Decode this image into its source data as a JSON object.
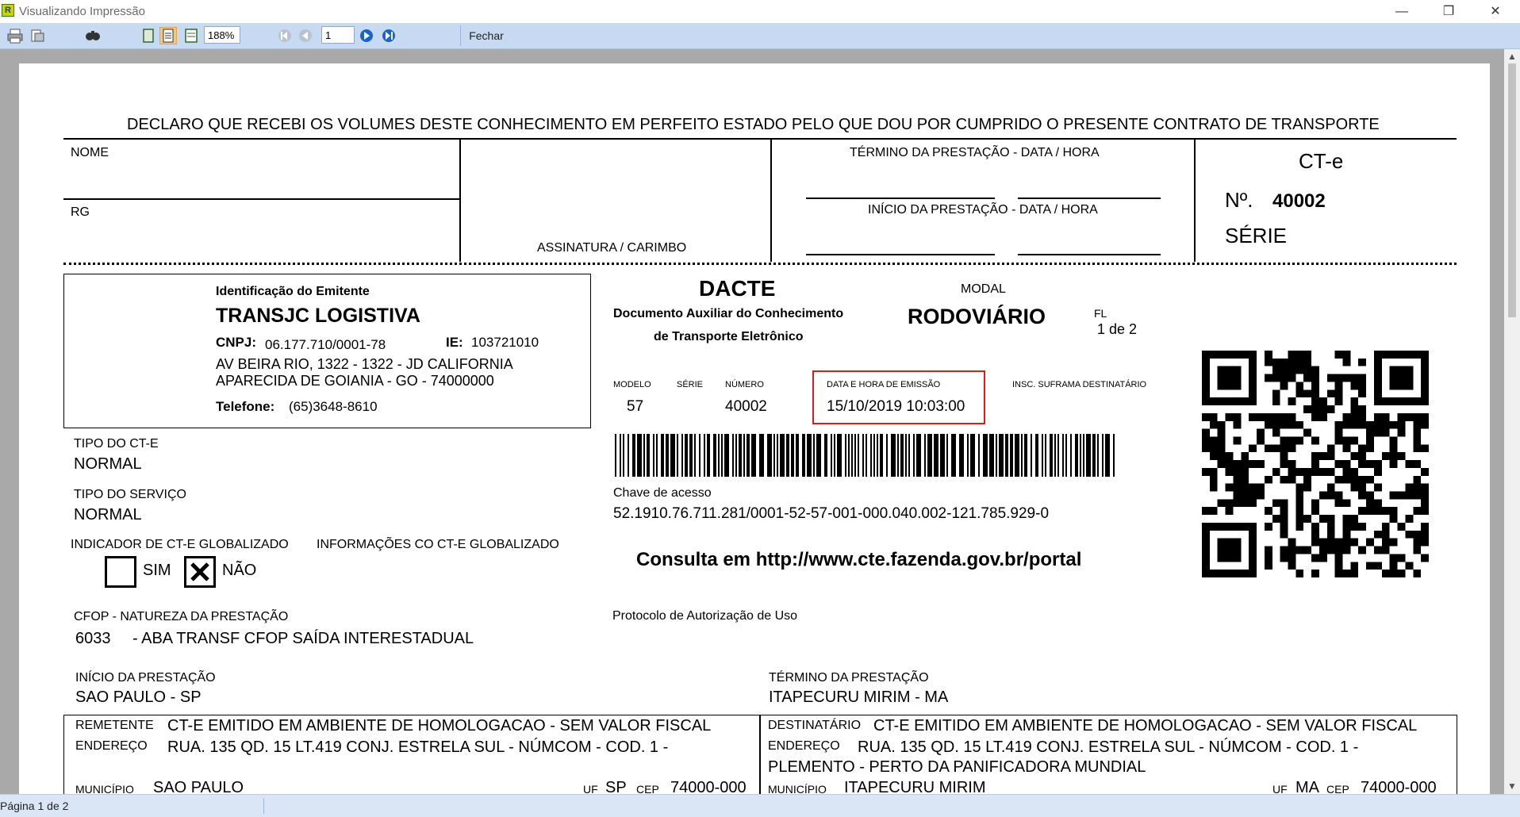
{
  "window": {
    "title": "Visualizando Impressão"
  },
  "toolbar": {
    "zoom": "188%",
    "page": "1",
    "close_label": "Fechar"
  },
  "status": {
    "page_info": "Página 1 de 2"
  },
  "doc": {
    "declaration": "DECLARO QUE RECEBI OS VOLUMES DESTE CONHECIMENTO EM PERFEITO ESTADO PELO QUE DOU POR CUMPRIDO O PRESENTE CONTRATO DE TRANSPORTE",
    "receipt": {
      "nome": "NOME",
      "rg": "RG",
      "assinatura": "ASSINATURA / CARIMBO",
      "termino": "TÉRMINO DA PRESTAÇÃO - DATA / HORA",
      "inicio": "INÍCIO DA PRESTAÇÃO - DATA / HORA",
      "cte": "CT-e",
      "no_label": "Nº.",
      "no_value": "40002",
      "serie": "SÉRIE"
    },
    "emitente": {
      "heading": "Identificação do Emitente",
      "name": "TRANSJC LOGISTIVA",
      "cnpj_label": "CNPJ:",
      "cnpj": "06.177.710/0001-78",
      "ie_label": "IE:",
      "ie": "103721010",
      "address1": "AV BEIRA RIO, 1322 - 1322 - JD CALIFORNIA",
      "address2": "APARECIDA DE GOIANIA - GO - 74000000",
      "phone_label": "Telefone:",
      "phone": "(65)3648-8610"
    },
    "dacte": {
      "title": "DACTE",
      "subtitle1": "Documento Auxiliar do Conhecimento",
      "subtitle2": "de Transporte Eletrônico",
      "modal_label": "MODAL",
      "modal": "RODOVIÁRIO",
      "fl_label": "FL",
      "fl": "1 de 2",
      "modelo_label": "MODELO",
      "modelo": "57",
      "serie_label": "SÉRIE",
      "numero_label": "NÚMERO",
      "numero": "40002",
      "emissao_label": "DATA E HORA DE EMISSÃO",
      "emissao": "15/10/2019 10:03:00",
      "suframa_label": "INSC. SUFRAMA DESTINATÁRIO",
      "chave_label": "Chave de acesso",
      "chave": "52.1910.76.711.281/0001-52-57-001-000.040.002-121.785.929-0",
      "consulta": "Consulta em http://www.cte.fazenda.gov.br/portal",
      "protocolo": "Protocolo de Autorização de Uso"
    },
    "tipo_cte_label": "TIPO DO CT-E",
    "tipo_cte": "NORMAL",
    "tipo_servico_label": "TIPO DO SERVIÇO",
    "tipo_servico": "NORMAL",
    "globalizado_label": "INDICADOR DE CT-E GLOBALIZADO",
    "info_globalizado_label": "INFORMAÇÕES CO CT-E GLOBALIZADO",
    "sim": "SIM",
    "nao": "NÃO",
    "cfop_label": "CFOP - NATUREZA DA PRESTAÇÃO",
    "cfop_code": "6033",
    "cfop_desc": "- ABA TRANSF CFOP SAÍDA INTERESTADUAL",
    "inicio_label": "INÍCIO DA PRESTAÇÃO",
    "inicio": "SAO PAULO - SP",
    "termino_label": "TÉRMINO DA PRESTAÇÃO",
    "termino": "ITAPECURU MIRIM - MA",
    "remetente": {
      "label": "REMETENTE",
      "value": "CT-E EMITIDO EM AMBIENTE DE HOMOLOGACAO - SEM VALOR FISCAL",
      "endereco_label": "ENDEREÇO",
      "endereco": "RUA. 135 QD. 15 LT.419 CONJ. ESTRELA SUL - NÚMCOM - COD. 1 -",
      "municipio_label": "MUNICÍPIO",
      "municipio": "SAO PAULO",
      "uf_label": "UF",
      "uf": "SP",
      "cep_label": "CEP",
      "cep": "74000-000"
    },
    "destinatario": {
      "label": "DESTINATÁRIO",
      "value": "CT-E EMITIDO EM AMBIENTE DE HOMOLOGACAO - SEM VALOR FISCAL",
      "endereco_label": "ENDEREÇO",
      "endereco": "RUA. 135 QD. 15 LT.419 CONJ. ESTRELA SUL - NÚMCOM - COD. 1 -",
      "endereco2": "PLEMENTO - PERTO DA PANIFICADORA MUNDIAL",
      "municipio_label": "MUNICÍPIO",
      "municipio": "ITAPECURU MIRIM",
      "uf_label": "UF",
      "uf": "MA",
      "cep_label": "CEP",
      "cep": "74000-000"
    }
  }
}
